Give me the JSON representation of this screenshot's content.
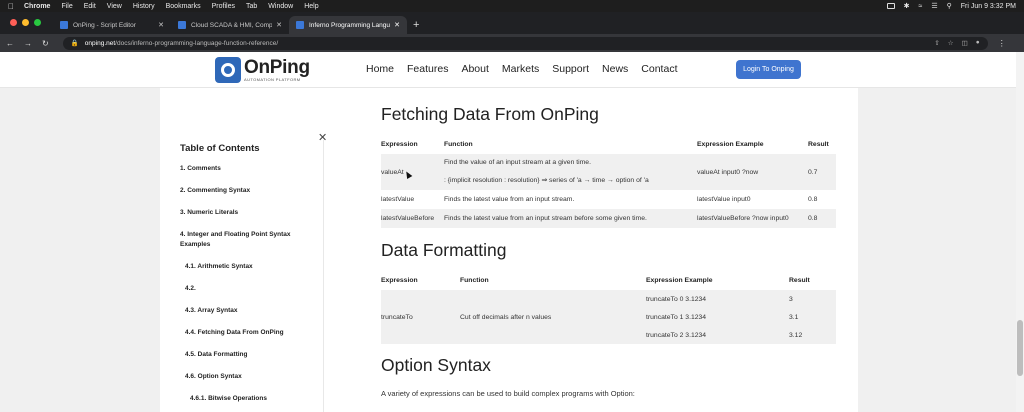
{
  "menubar": {
    "app": "Chrome",
    "items": [
      "File",
      "Edit",
      "View",
      "History",
      "Bookmarks",
      "Profiles",
      "Tab",
      "Window",
      "Help"
    ],
    "clock": "Fri Jun 9  3:32 PM"
  },
  "tabs": [
    {
      "title": "OnPing - Script Editor"
    },
    {
      "title": "Cloud SCADA & HMI, Complet..."
    },
    {
      "title": "Inferno Programming Languag..."
    }
  ],
  "address": {
    "host": "onping.net",
    "path": "/docs/inferno-programming-language-function-reference/"
  },
  "header": {
    "logo_name": "OnPing",
    "logo_tagline": "AUTOMATION PLATFORM",
    "nav": [
      "Home",
      "Features",
      "About",
      "Markets",
      "Support",
      "News",
      "Contact"
    ],
    "login_label": "Login To Onping"
  },
  "toc": {
    "title": "Table of Contents",
    "items": [
      {
        "label": "1. Comments"
      },
      {
        "label": "2. Commenting Syntax"
      },
      {
        "label": "3. Numeric Literals"
      },
      {
        "label": "4. Integer and Floating Point Syntax Examples"
      },
      {
        "label": "4.1. Arithmetic Syntax"
      },
      {
        "label": "4.2."
      },
      {
        "label": "4.3. Array Syntax"
      },
      {
        "label": "4.4. Fetching Data From OnPing"
      },
      {
        "label": "4.5. Data Formatting"
      },
      {
        "label": "4.6. Option Syntax"
      },
      {
        "label": "4.6.1. Bitwise Operations"
      }
    ]
  },
  "section1": {
    "title": "Fetching Data From OnPing",
    "headers": [
      "Expression",
      "Function",
      "Expression Example",
      "Result"
    ],
    "rows": [
      {
        "expr": "valueAt",
        "func": "Find the value of an input stream at a given time.",
        "func2": ": {implicit resolution : resolution} ⇒ series of 'a → time → option of 'a",
        "example": "valueAt input0 ?now",
        "result": "0.7"
      },
      {
        "expr": "latestValue",
        "func": "Finds the latest value from an input stream.",
        "example": "latestValue input0",
        "result": "0.8"
      },
      {
        "expr": "latestValueBefore",
        "func": "Finds the latest value from an input stream before some given time.",
        "example": "latestValueBefore ?now input0",
        "result": "0.8"
      }
    ]
  },
  "section2": {
    "title": "Data Formatting",
    "headers": [
      "Expression",
      "Function",
      "Expression Example",
      "Result"
    ],
    "expr": "truncateTo",
    "func": "Cut off decimals after n values",
    "examples": [
      {
        "example": "truncateTo 0 3.1234",
        "result": "3"
      },
      {
        "example": "truncateTo 1 3.1234",
        "result": "3.1"
      },
      {
        "example": "truncateTo 2 3.1234",
        "result": "3.12"
      }
    ]
  },
  "section3": {
    "title": "Option Syntax",
    "text": "A variety of expressions can be used to build complex programs with Option:"
  }
}
